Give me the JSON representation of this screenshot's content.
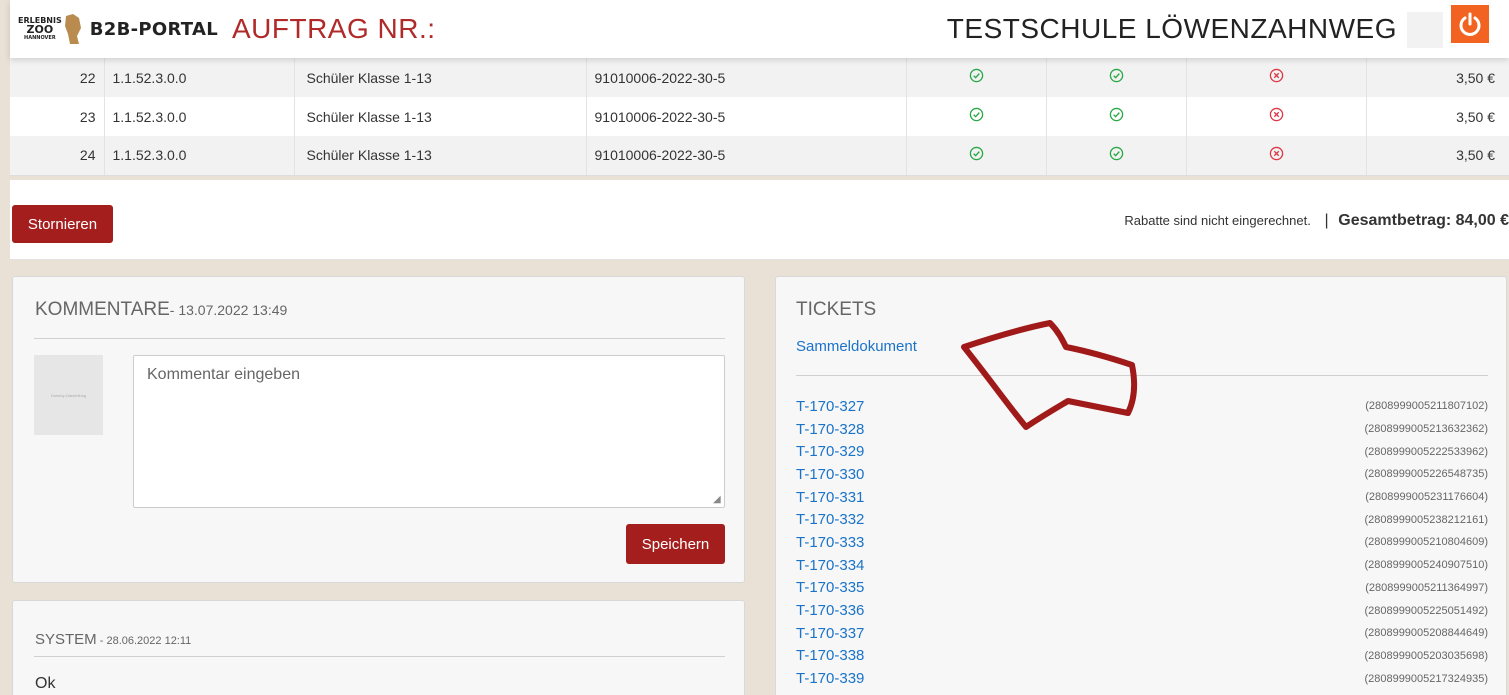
{
  "header": {
    "logo_line1": "ERLEBNIS",
    "logo_line2": "ZOO",
    "logo_line3": "HANNOVER",
    "brand": "B2B-PORTAL",
    "order_title": "AUFTRAG NR.:",
    "school_name": "TESTSCHULE LÖWENZAHNWEG",
    "power_icon": "power-icon",
    "accent_color": "#f26322"
  },
  "order_rows": [
    {
      "num": "22",
      "code": "1.1.52.3.0.0",
      "name": "Schüler Klasse 1-13",
      "article": "91010006-2022-30-5",
      "status1": "ok",
      "status2": "ok",
      "status3": "no",
      "price": "3,50 €"
    },
    {
      "num": "23",
      "code": "1.1.52.3.0.0",
      "name": "Schüler Klasse 1-13",
      "article": "91010006-2022-30-5",
      "status1": "ok",
      "status2": "ok",
      "status3": "no",
      "price": "3,50 €"
    },
    {
      "num": "24",
      "code": "1.1.52.3.0.0",
      "name": "Schüler Klasse 1-13",
      "article": "91010006-2022-30-5",
      "status1": "ok",
      "status2": "ok",
      "status3": "no",
      "price": "3,50 €"
    }
  ],
  "actions": {
    "cancel_label": "Stornieren",
    "discount_note": "Rabatte sind nicht eingerechnet.",
    "separator": "|",
    "total_label": "Gesamtbetrag: 84,00 €"
  },
  "comments": {
    "title": "KOMMENTARE",
    "timestamp": "- 13.07.2022 13:49",
    "avatar_text": "Dummy-Darstellung",
    "input_placeholder": "Kommentar eingeben",
    "save_label": "Speichern"
  },
  "system": {
    "title": "SYSTEM",
    "timestamp": " - 28.06.2022 12:11",
    "text": "Ok"
  },
  "tickets": {
    "title": "TICKETS",
    "collection_link": "Sammeldokument",
    "items": [
      {
        "id": "T-170-327",
        "code": "(2808999005211807102)"
      },
      {
        "id": "T-170-328",
        "code": "(2808999005213632362)"
      },
      {
        "id": "T-170-329",
        "code": "(2808999005222533962)"
      },
      {
        "id": "T-170-330",
        "code": "(2808999005226548735)"
      },
      {
        "id": "T-170-331",
        "code": "(2808999005231176604)"
      },
      {
        "id": "T-170-332",
        "code": "(2808999005238212161)"
      },
      {
        "id": "T-170-333",
        "code": "(2808999005210804609)"
      },
      {
        "id": "T-170-334",
        "code": "(2808999005240907510)"
      },
      {
        "id": "T-170-335",
        "code": "(2808999005211364997)"
      },
      {
        "id": "T-170-336",
        "code": "(2808999005225051492)"
      },
      {
        "id": "T-170-337",
        "code": "(2808999005208844649)"
      },
      {
        "id": "T-170-338",
        "code": "(2808999005203035698)"
      },
      {
        "id": "T-170-339",
        "code": "(2808999005217324935)"
      }
    ]
  },
  "colors": {
    "brand_red": "#a51e1e",
    "title_red": "#b02a2a",
    "link_blue": "#1a73c9",
    "ok_green": "#28a745",
    "error_red": "#dc3545",
    "annotation_red": "#a01a1a"
  },
  "annotation": "hand-drawn-arrow-icon"
}
